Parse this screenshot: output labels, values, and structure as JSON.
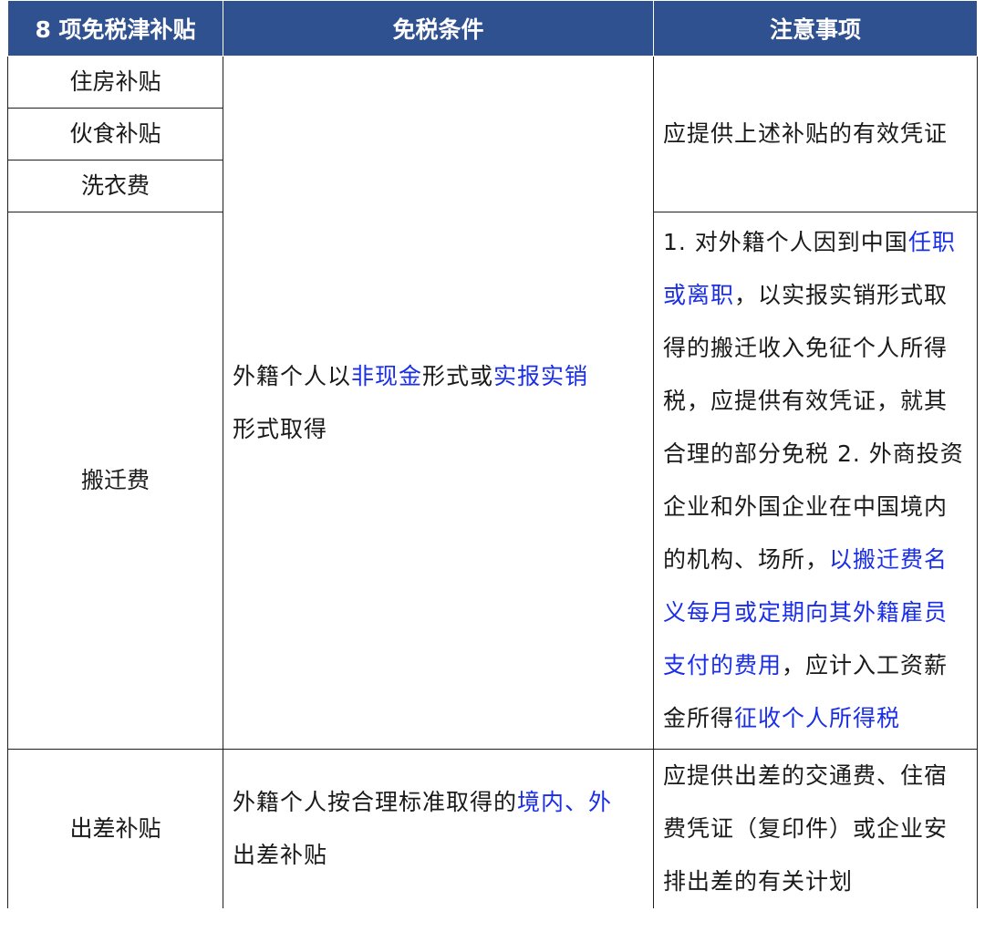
{
  "header": {
    "col1": "8 项免税津补贴",
    "col2": "免税条件",
    "col3": "注意事项"
  },
  "rows": {
    "housing": "住房补贴",
    "meal": "伙食补贴",
    "laundry": "洗衣费",
    "relocation": "搬迁费",
    "travel": "出差补贴"
  },
  "condition_main": {
    "p1": "外籍个人以",
    "h1": "非现金",
    "p2": "形式或",
    "h2": "实报实销",
    "p3": "形式取得"
  },
  "condition_travel": {
    "p1": "外籍个人按合理标准取得的",
    "h1": "境内、外",
    "p2": "出差补贴"
  },
  "note_voucher": "应提供上述补贴的有效凭证",
  "note_relocation": {
    "p1": "1. 对外籍个人因到中国",
    "h1": "任职或离职",
    "p2": "，以实报实销形式取得的搬迁收入免征个人所得税，应提供有效凭证，就其合理的部分免税 2. 外商投资企业和外国企业在中国境内的机构、场所，",
    "h2": "以搬迁费名义每月或定期向其外籍雇员支付的费用",
    "p3": "，应计入工资薪金所得",
    "h3": "征收个人所得税"
  },
  "note_travel": "应提供出差的交通费、住宿费凭证（复印件）或企业安排出差的有关计划",
  "colors": {
    "header_bg": "#2f5190",
    "highlight": "#1a2ee6"
  }
}
